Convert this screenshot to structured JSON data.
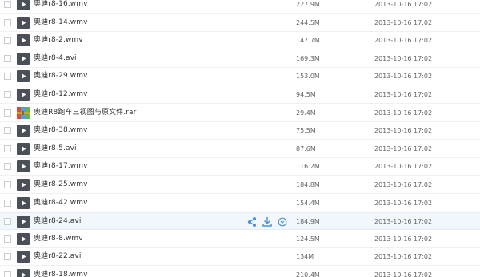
{
  "colors": {
    "row_hover_bg": "#f2f7fd",
    "divider": "#eef0f3",
    "text": "#333333",
    "meta_text": "#666666",
    "action_blue": "#4a90d9",
    "video_icon_bg": "#4a4f5a"
  },
  "row_actions": {
    "icons": [
      "share-icon",
      "download-icon",
      "more-icon"
    ]
  },
  "files": [
    {
      "name": "奥迪r8-16.wmv",
      "size": "227.9M",
      "date": "2013-10-16 17:02",
      "type": "video"
    },
    {
      "name": "奥迪r8-14.wmv",
      "size": "244.5M",
      "date": "2013-10-16 17:02",
      "type": "video"
    },
    {
      "name": "奥迪r8-2.wmv",
      "size": "147.7M",
      "date": "2013-10-16 17:02",
      "type": "video"
    },
    {
      "name": "奥迪r8-4.avi",
      "size": "169.3M",
      "date": "2013-10-16 17:02",
      "type": "video"
    },
    {
      "name": "奥迪r8-29.wmv",
      "size": "153.0M",
      "date": "2013-10-16 17:02",
      "type": "video"
    },
    {
      "name": "奥迪r8-12.wmv",
      "size": "94.5M",
      "date": "2013-10-16 17:02",
      "type": "video"
    },
    {
      "name": "奥迪R8跑车三视图与原文件.rar",
      "size": "29.4M",
      "date": "2013-10-16 17:02",
      "type": "archive"
    },
    {
      "name": "奥迪r8-38.wmv",
      "size": "75.5M",
      "date": "2013-10-16 17:02",
      "type": "video"
    },
    {
      "name": "奥迪r8-5.avi",
      "size": "87.6M",
      "date": "2013-10-16 17:02",
      "type": "video"
    },
    {
      "name": "奥迪r8-17.wmv",
      "size": "116.2M",
      "date": "2013-10-16 17:02",
      "type": "video"
    },
    {
      "name": "奥迪r8-25.wmv",
      "size": "184.8M",
      "date": "2013-10-16 17:02",
      "type": "video"
    },
    {
      "name": "奥迪r8-42.wmv",
      "size": "154.4M",
      "date": "2013-10-16 17:02",
      "type": "video"
    },
    {
      "name": "奥迪r8-24.avi",
      "size": "184.9M",
      "date": "2013-10-16 17:02",
      "type": "video",
      "hover": true
    },
    {
      "name": "奥迪r8-8.wmv",
      "size": "124.5M",
      "date": "2013-10-16 17:02",
      "type": "video"
    },
    {
      "name": "奥迪r8-22.avi",
      "size": "134M",
      "date": "2013-10-16 17:02",
      "type": "video"
    },
    {
      "name": "奥迪r8-18.wmv",
      "size": "210.4M",
      "date": "2013-10-16 17:02",
      "type": "video"
    }
  ]
}
